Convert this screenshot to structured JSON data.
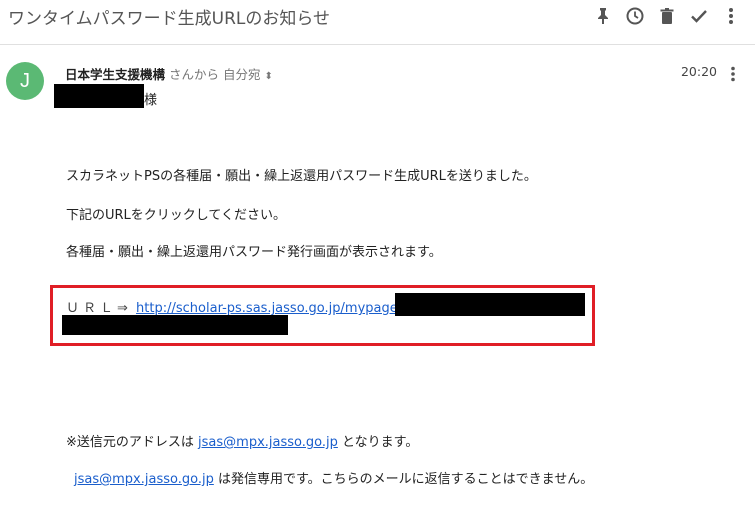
{
  "subject": "ワンタイムパスワード生成URLのお知らせ",
  "toolbar": {
    "icons": [
      "pin-icon",
      "clock-icon",
      "trash-icon",
      "check-icon",
      "more-vert-icon"
    ]
  },
  "sender": {
    "avatar_letter": "J",
    "avatar_color": "#5bb974",
    "name": "日本学生支援機構",
    "meta": "さんから 自分宛",
    "time": "20:20"
  },
  "body": {
    "salutation": "様",
    "line1": "スカラネットPSの各種届・願出・繰上返還用パスワード生成URLを送りました。",
    "line2": "下記のURLをクリックしてください。",
    "line3": "各種届・願出・繰上返還用パスワード発行画面が表示されます。",
    "url_label": "ＵＲＬ⇒",
    "url_text": "http://scholar-ps.sas.jasso.go.jp/mypage/",
    "note_prefix": "※送信元のアドレスは",
    "note_email": "jsas@mpx.jasso.go.jp",
    "note_suffix": "となります。",
    "footer_email": "jsas@mpx.jasso.go.jp",
    "footer_text": "は発信専用です。こちらのメールに返信することはできません。"
  },
  "colors": {
    "link": "#1a5ecc",
    "highlight_box": "#e01e26"
  }
}
